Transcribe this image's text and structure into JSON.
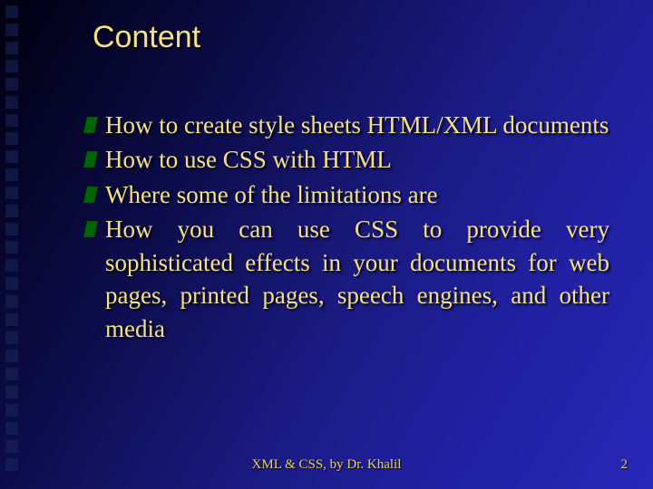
{
  "title": "Content",
  "bullets": [
    "How to create style sheets HTML/XML documents",
    "How to use CSS with HTML",
    "Where some of the limitations are",
    "How you can use CSS to provide very sophisticated effects in your documents for web pages, printed pages, speech engines, and other media"
  ],
  "footer": "XML & CSS, by Dr. Khalil",
  "page_number": "2",
  "colors": {
    "accent_text": "#f5e08a",
    "bullet_green": "#006400"
  }
}
